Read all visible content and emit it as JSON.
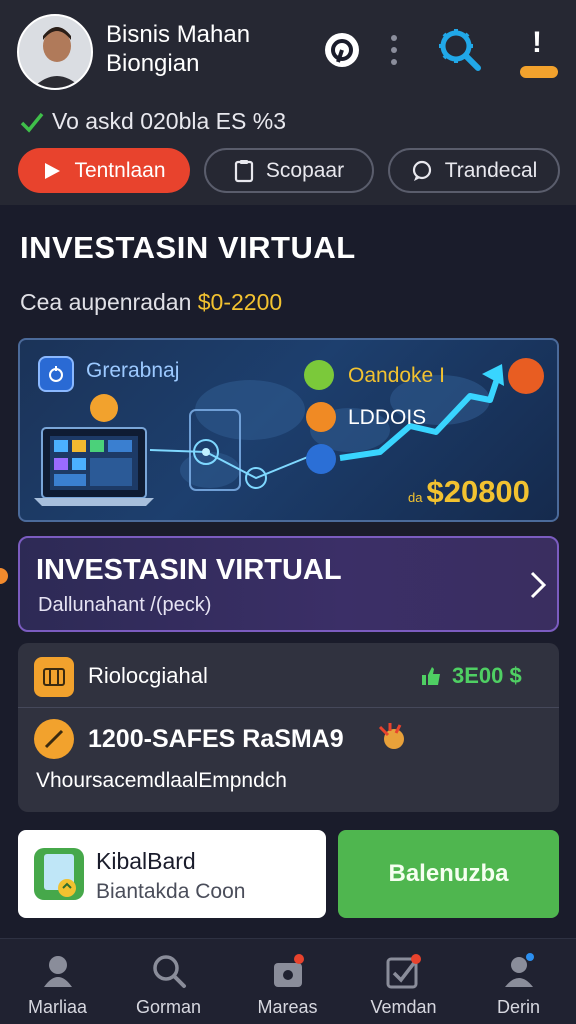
{
  "header": {
    "user_name": "Bisnis Mahan Biongian",
    "status_text": "Vo askd 020bla ES %3",
    "badge_label": "!",
    "pills": [
      {
        "label": "Tentnlaan",
        "icon": "play-icon"
      },
      {
        "label": "Scopaar",
        "icon": "clipboard-icon"
      },
      {
        "label": "Trandecal",
        "icon": "chat-icon"
      }
    ]
  },
  "main": {
    "title": "INVESTASIN VIRTUAL",
    "subtitle_prefix": "Cea aupenradan",
    "subtitle_amount": "$0-2200"
  },
  "banner": {
    "label_left": "Grerabnaj",
    "label_top": "Oandoke I",
    "label_mid": "LDDOIS",
    "amount_prefix": "da",
    "amount": "$20800",
    "accent": "#f2c230"
  },
  "promo": {
    "title": "INVESTASIN VIRTUAL",
    "subtitle": "Dallunahant /(peck)"
  },
  "card": {
    "row1_label": "Riolocgiahal",
    "row1_value": "3E00 $",
    "row2_label": "1200-SAFES RaSMA9",
    "row3_text": "VhoursacemdlaalEmpndch"
  },
  "actions": {
    "white_title": "KibalBard",
    "white_sub": "Biantakda Coon",
    "green_label": "Balenuzba"
  },
  "nav": {
    "items": [
      {
        "label": "Marliaa",
        "icon": "home-icon"
      },
      {
        "label": "Gorman",
        "icon": "search-icon"
      },
      {
        "label": "Mareas",
        "icon": "bag-icon"
      },
      {
        "label": "Vemdan",
        "icon": "edit-icon"
      },
      {
        "label": "Derin",
        "icon": "user-icon"
      }
    ]
  },
  "colors": {
    "background": "#1a1c2b",
    "header": "#262833",
    "red": "#e8432d",
    "green": "#4fb64f",
    "gold": "#f2c230",
    "purple_border": "#7b5cc0"
  }
}
